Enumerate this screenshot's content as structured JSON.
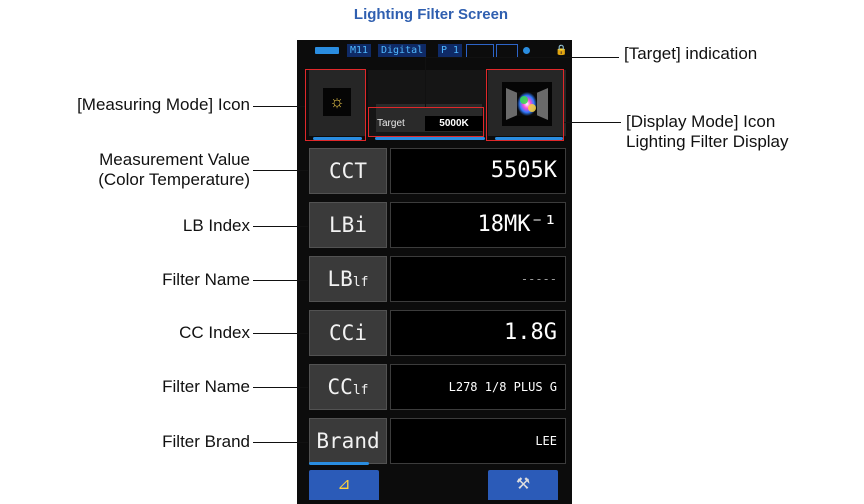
{
  "page_title": "Lighting Filter Screen",
  "status_bar": {
    "memory": "M11",
    "mode": "Digital",
    "page": "P 1"
  },
  "top_row": {
    "measuring_mode_icon": "sun-icon",
    "target_label": "Target",
    "target_value": "5000K",
    "display_mode_icon": "lighting-filter-display-icon"
  },
  "rows": [
    {
      "label": "CCT",
      "sub": "",
      "value": "5505K"
    },
    {
      "label": "LBi",
      "sub": "",
      "value": "18MK⁻¹"
    },
    {
      "label": "LB",
      "sub": "lf",
      "value": "-----"
    },
    {
      "label": "CCi",
      "sub": "",
      "value": "1.8G"
    },
    {
      "label": "CC",
      "sub": "lf",
      "value": "L278 1/8 PLUS G"
    },
    {
      "label": "Brand",
      "sub": "",
      "value": "LEE"
    }
  ],
  "buttons": {
    "left_icon": "delta-icon",
    "left_glyph": "⊿",
    "right_icon": "wrench-icon",
    "right_glyph": "⚒"
  },
  "callouts": {
    "target_indication": "[Target] indication",
    "measuring_mode": "[Measuring Mode] Icon",
    "display_mode_line1": "[Display Mode] Icon",
    "display_mode_line2": "Lighting Filter Display",
    "measurement_value_line1": "Measurement Value",
    "measurement_value_line2": "(Color Temperature)",
    "lb_index": "LB Index",
    "filter_name_1": "Filter Name",
    "cc_index": "CC Index",
    "filter_name_2": "Filter Name",
    "filter_brand": "Filter Brand"
  },
  "colors": {
    "title": "#2f5fb0",
    "accent_blue": "#2a8de0",
    "callout_box": "#e0282a",
    "button": "#2b5bb8"
  }
}
